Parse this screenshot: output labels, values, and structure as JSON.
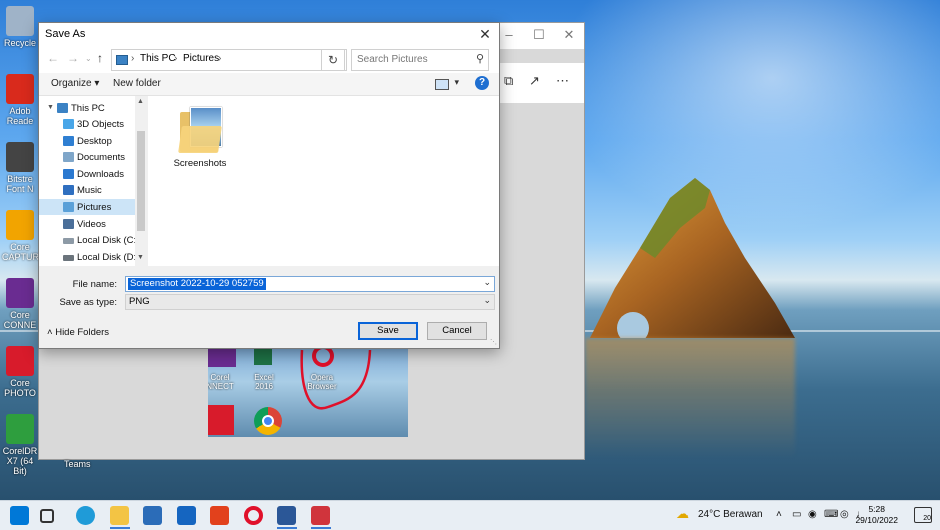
{
  "desktop": {
    "icons": [
      {
        "label": "Recycle",
        "color": "#9fb3c8"
      },
      {
        "label": "Adob Reade",
        "color": "#d92a1c"
      },
      {
        "label": "Bitstre Font N",
        "color": "#444444"
      },
      {
        "label": "Core CAPTUR",
        "color": "#f2a400"
      },
      {
        "label": "Core CONNE",
        "color": "#6a2c91"
      },
      {
        "label": "Core PHOTO",
        "color": "#d81b2b"
      },
      {
        "label": "CorelDR X7 (64 Bit)",
        "color": "#2e9e3e"
      }
    ],
    "thumb_labels": [
      "Corel NNECT",
      "Excel 2016",
      "Opera Browser"
    ],
    "teams_label": "Teams"
  },
  "dialog": {
    "title": "Save As",
    "breadcrumb": [
      "This PC",
      "Pictures"
    ],
    "search_placeholder": "Search Pictures",
    "organize_label": "Organize",
    "new_folder_label": "New folder",
    "nav_items": [
      {
        "label": "This PC",
        "icon": "this-pc-icon",
        "color": "#3b82c4"
      },
      {
        "label": "3D Objects",
        "icon": "3d-objects-icon",
        "color": "#49a6e8"
      },
      {
        "label": "Desktop",
        "icon": "desktop-icon",
        "color": "#2f7fd2"
      },
      {
        "label": "Documents",
        "icon": "documents-icon",
        "color": "#7fa6c9"
      },
      {
        "label": "Downloads",
        "icon": "downloads-icon",
        "color": "#2b79d0"
      },
      {
        "label": "Music",
        "icon": "music-icon",
        "color": "#2f6fc0"
      },
      {
        "label": "Pictures",
        "icon": "pictures-icon",
        "color": "#5aa0d8"
      },
      {
        "label": "Videos",
        "icon": "videos-icon",
        "color": "#4b6f99"
      },
      {
        "label": "Local Disk (C:)",
        "icon": "drive-c-icon",
        "color": "#8d9aa6"
      },
      {
        "label": "Local Disk (D:)",
        "icon": "drive-d-icon",
        "color": "#6b747c"
      }
    ],
    "selected_nav": "Pictures",
    "folder_label": "Screenshots",
    "file_name_label": "File name:",
    "file_name_value": "Screenshot 2022-10-29 052759",
    "save_type_label": "Save as type:",
    "save_type_value": "PNG",
    "hide_folders_label": "Hide Folders",
    "save_label": "Save",
    "cancel_label": "Cancel"
  },
  "taskbar": {
    "weather": "24°C  Berawan",
    "time": "5:28",
    "date": "29/10/2022",
    "notification_count": "20",
    "apps": [
      {
        "name": "windows-start-icon",
        "color": "#0078d7"
      },
      {
        "name": "search-icon",
        "color": "#333333"
      },
      {
        "name": "task-view-icon",
        "color": "#333333"
      },
      {
        "name": "edge-icon",
        "color": "#1f9bd8"
      },
      {
        "name": "file-explorer-icon",
        "color": "#f3c444"
      },
      {
        "name": "store-icon",
        "color": "#2b6cb8"
      },
      {
        "name": "mail-icon",
        "color": "#1565c0"
      },
      {
        "name": "office-icon",
        "color": "#e2411c"
      },
      {
        "name": "opera-icon",
        "color": "#e0102a"
      },
      {
        "name": "word-icon",
        "color": "#2b5797"
      },
      {
        "name": "snipping-tool-icon",
        "color": "#d0343c"
      }
    ]
  }
}
